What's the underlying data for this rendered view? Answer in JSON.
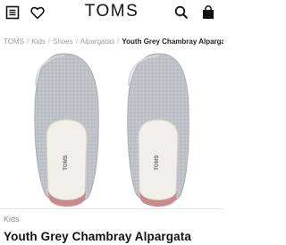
{
  "header": {
    "logo": "TOMS",
    "menu_icon": "menu-icon",
    "wishlist_icon": "heart-icon",
    "search_icon": "search-icon",
    "cart_icon": "shopping-bag-icon"
  },
  "breadcrumb": {
    "items": [
      "TOMS",
      "Kids",
      "Shoes",
      "Alpargatas"
    ],
    "current": "Youth Grey Chambray Alpargata"
  },
  "product": {
    "category": "Kids",
    "title": "Youth Grey Chambray Alpargata",
    "insole_brand": "TOMS",
    "colors": {
      "upper": "#b9bcc2",
      "heel": "#c98a8c",
      "insole": "#f1efe9"
    }
  }
}
